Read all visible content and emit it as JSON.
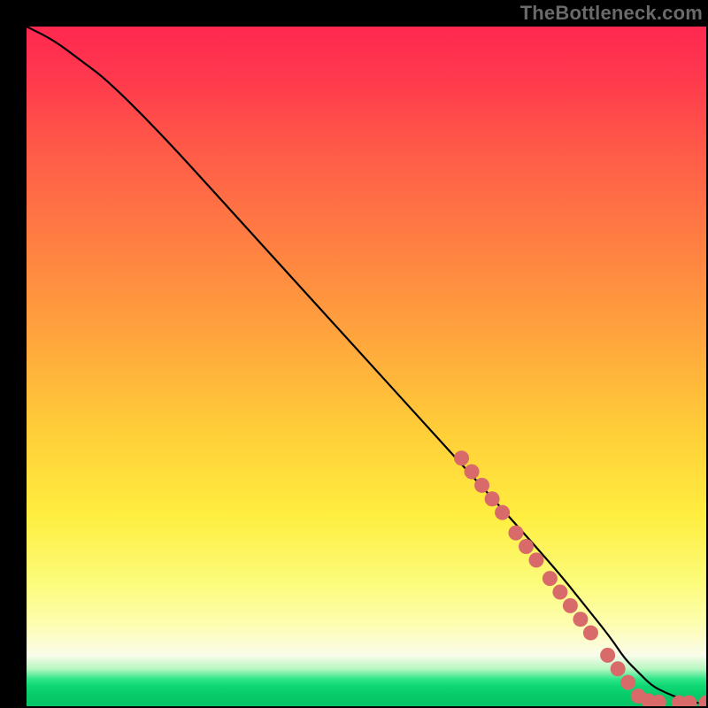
{
  "watermark": "TheBottleneck.com",
  "chart_data": {
    "type": "line",
    "title": "",
    "xlabel": "",
    "ylabel": "",
    "xlim": [
      0,
      100
    ],
    "ylim": [
      0,
      100
    ],
    "grid": false,
    "legend": false,
    "line": {
      "name": "curve",
      "x": [
        0,
        4,
        8,
        12,
        20,
        30,
        40,
        50,
        60,
        70,
        78,
        82,
        86,
        88,
        90,
        92,
        94,
        96,
        98,
        100
      ],
      "y": [
        100,
        98,
        95,
        92,
        84,
        73,
        62,
        51,
        40,
        29,
        20,
        15,
        10,
        7,
        5,
        3,
        2,
        1.2,
        0.6,
        0.3
      ]
    },
    "dot_series": {
      "name": "highlighted-points",
      "color": "#d86a6a",
      "points": [
        {
          "x": 64,
          "y": 36.5
        },
        {
          "x": 65.5,
          "y": 34.5
        },
        {
          "x": 67,
          "y": 32.5
        },
        {
          "x": 68.5,
          "y": 30.5
        },
        {
          "x": 70,
          "y": 28.5
        },
        {
          "x": 72,
          "y": 25.5
        },
        {
          "x": 73.5,
          "y": 23.5
        },
        {
          "x": 75,
          "y": 21.5
        },
        {
          "x": 77,
          "y": 18.8
        },
        {
          "x": 78.5,
          "y": 16.8
        },
        {
          "x": 80,
          "y": 14.8
        },
        {
          "x": 81.5,
          "y": 12.8
        },
        {
          "x": 83,
          "y": 10.8
        },
        {
          "x": 85.5,
          "y": 7.5
        },
        {
          "x": 87,
          "y": 5.5
        },
        {
          "x": 88.5,
          "y": 3.5
        },
        {
          "x": 90,
          "y": 1.5
        },
        {
          "x": 91.5,
          "y": 0.8
        },
        {
          "x": 93,
          "y": 0.6
        },
        {
          "x": 96,
          "y": 0.5
        },
        {
          "x": 97.5,
          "y": 0.5
        },
        {
          "x": 100,
          "y": 0.5
        }
      ]
    },
    "gradient_stops": [
      {
        "pct": 0,
        "color": "#ff2850"
      },
      {
        "pct": 45,
        "color": "#ffa33d"
      },
      {
        "pct": 72,
        "color": "#ffee40"
      },
      {
        "pct": 92,
        "color": "#fafceb"
      },
      {
        "pct": 96,
        "color": "#2fe68a"
      },
      {
        "pct": 100,
        "color": "#05c566"
      }
    ]
  }
}
